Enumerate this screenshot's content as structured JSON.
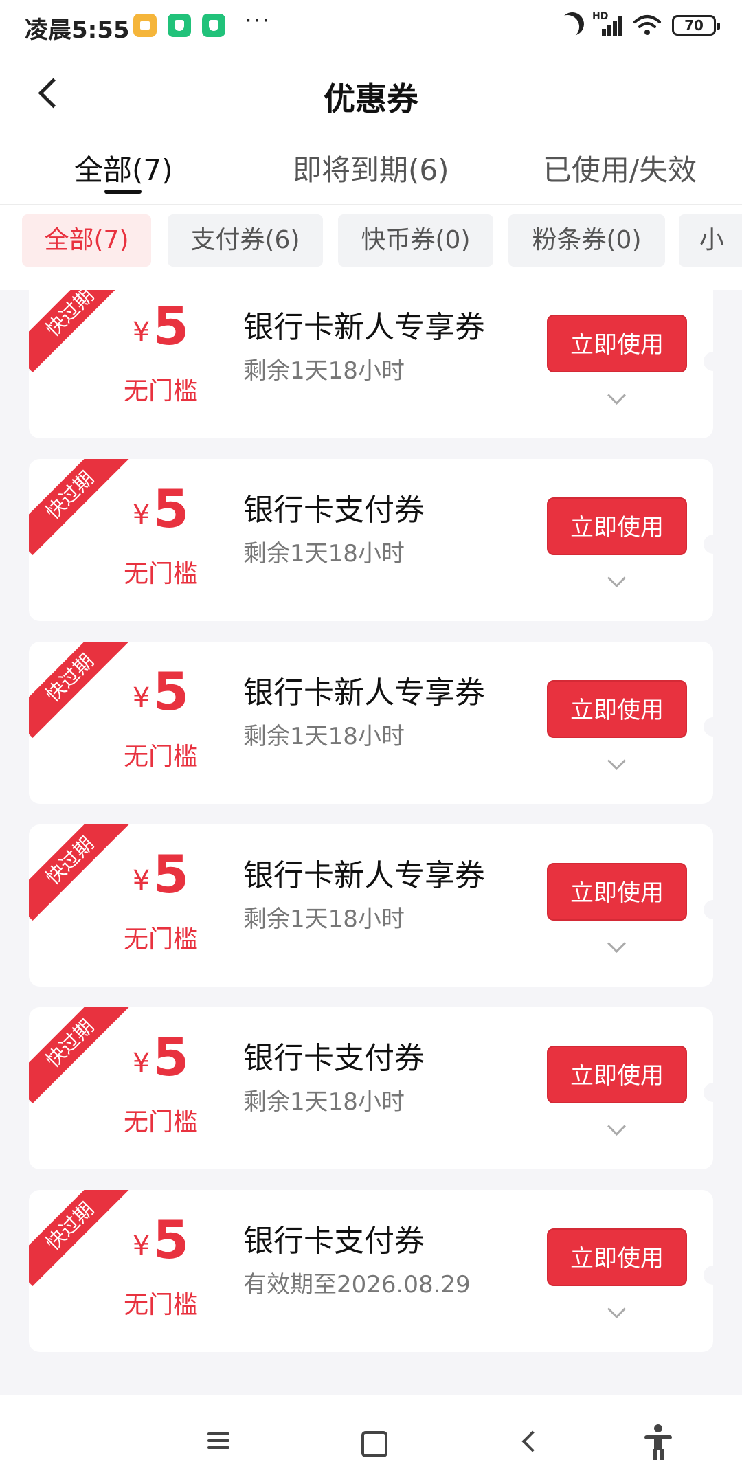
{
  "status_bar": {
    "time": "凌晨5:55",
    "more": "···",
    "hd_label": "HD",
    "battery": "70",
    "notifications": [
      "notes-icon",
      "shield-icon",
      "shield-icon"
    ]
  },
  "header": {
    "title": "优惠券"
  },
  "tabs": [
    {
      "label": "全部(7)",
      "active": true
    },
    {
      "label": "即将到期(6)",
      "active": false
    },
    {
      "label": "已使用/失效",
      "active": false
    }
  ],
  "filters": [
    {
      "label": "全部(7)",
      "active": true
    },
    {
      "label": "支付券(6)",
      "active": false
    },
    {
      "label": "快币券(0)",
      "active": false
    },
    {
      "label": "粉条券(0)",
      "active": false
    },
    {
      "label": "小",
      "active": false
    }
  ],
  "coupons": [
    {
      "ribbon": "快过期",
      "currency": "¥",
      "value": "5",
      "threshold": "无门槛",
      "name": "银行卡新人专享券",
      "expiry": "剩余1天18小时",
      "button": "立即使用"
    },
    {
      "ribbon": "快过期",
      "currency": "¥",
      "value": "5",
      "threshold": "无门槛",
      "name": "银行卡支付券",
      "expiry": "剩余1天18小时",
      "button": "立即使用"
    },
    {
      "ribbon": "快过期",
      "currency": "¥",
      "value": "5",
      "threshold": "无门槛",
      "name": "银行卡新人专享券",
      "expiry": "剩余1天18小时",
      "button": "立即使用"
    },
    {
      "ribbon": "快过期",
      "currency": "¥",
      "value": "5",
      "threshold": "无门槛",
      "name": "银行卡新人专享券",
      "expiry": "剩余1天18小时",
      "button": "立即使用"
    },
    {
      "ribbon": "快过期",
      "currency": "¥",
      "value": "5",
      "threshold": "无门槛",
      "name": "银行卡支付券",
      "expiry": "剩余1天18小时",
      "button": "立即使用"
    },
    {
      "ribbon": "快过期",
      "currency": "¥",
      "value": "5",
      "threshold": "无门槛",
      "name": "银行卡支付券",
      "expiry": "有效期至2026.08.29",
      "button": "立即使用"
    }
  ],
  "colors": {
    "accent": "#e8323f",
    "accent_bg": "#fdecec",
    "page_bg": "#f5f5f8"
  },
  "nav_bar": {
    "icons": [
      "menu-icon",
      "home-icon",
      "back-icon",
      "accessibility-icon"
    ]
  }
}
